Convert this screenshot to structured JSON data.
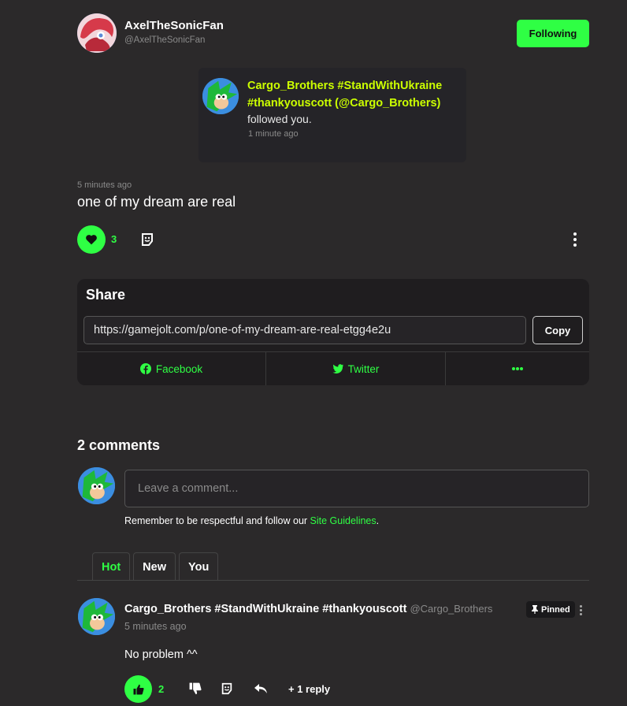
{
  "header": {
    "author_name": "AxelTheSonicFan",
    "author_handle": "@AxelTheSonicFan",
    "follow_label": "Following"
  },
  "notification": {
    "user": "Cargo_Brothers #StandWithUkraine #thankyouscott (@Cargo_Brothers)",
    "action": "followed you.",
    "time": "1 minute ago"
  },
  "post": {
    "time": "5 minutes ago",
    "text": "one of my dream are real",
    "like_count": "3"
  },
  "share": {
    "title": "Share",
    "url": "https://gamejolt.com/p/one-of-my-dream-are-real-etgg4e2u",
    "copy_label": "Copy",
    "facebook_label": "Facebook",
    "twitter_label": "Twitter"
  },
  "comments": {
    "heading": "2 comments",
    "input_placeholder": "Leave a comment...",
    "guidelines_prefix": "Remember to be respectful and follow our ",
    "guidelines_link": "Site Guidelines",
    "guidelines_suffix": ".",
    "tabs": [
      {
        "label": "Hot",
        "active": true
      },
      {
        "label": "New",
        "active": false
      },
      {
        "label": "You",
        "active": false
      }
    ],
    "items": [
      {
        "user": "Cargo_Brothers #StandWithUkraine #thankyouscott",
        "handle": "@Cargo_Brothers",
        "time": "5 minutes ago",
        "pinned_label": "Pinned",
        "text": "No problem ^^",
        "like_count": "2",
        "replies_label": "+ 1 reply"
      }
    ]
  },
  "colors": {
    "accent": "#2fff44",
    "highlight": "#ccff00",
    "background": "#2b292a",
    "panel": "#1f1d1f"
  }
}
